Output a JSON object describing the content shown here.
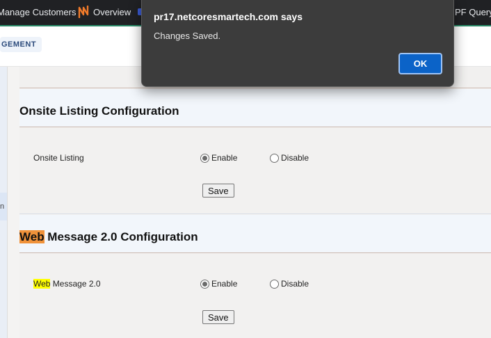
{
  "browser_tabs": [
    {
      "label": "Manage Customers"
    },
    {
      "label": "Overview"
    },
    {
      "label": "PF Query T"
    }
  ],
  "header": {
    "management_pill": "GEMENT"
  },
  "rail": {
    "partial_label": "n"
  },
  "sections": [
    {
      "title": "Onsite Listing Configuration",
      "row_label": "Onsite Listing",
      "enable_label": "Enable",
      "disable_label": "Disable",
      "selected": "Enable",
      "save_label": "Save"
    },
    {
      "title_highlight": "Web",
      "title_rest": " Message 2.0 Configuration",
      "row_label_highlight": "Web",
      "row_label_rest": " Message 2.0",
      "enable_label": "Enable",
      "disable_label": "Disable",
      "selected": "Enable",
      "save_label": "Save"
    }
  ],
  "dialog": {
    "title": "pr17.netcoresmartech.com says",
    "message": "Changes Saved.",
    "ok_label": "OK"
  },
  "colors": {
    "dialog_bg": "#3c3c3c",
    "ok_button": "#0b63c8",
    "highlight_orange": "#f0923a",
    "highlight_yellow": "#ffff00",
    "tab_accent": "#2b8d6a"
  }
}
